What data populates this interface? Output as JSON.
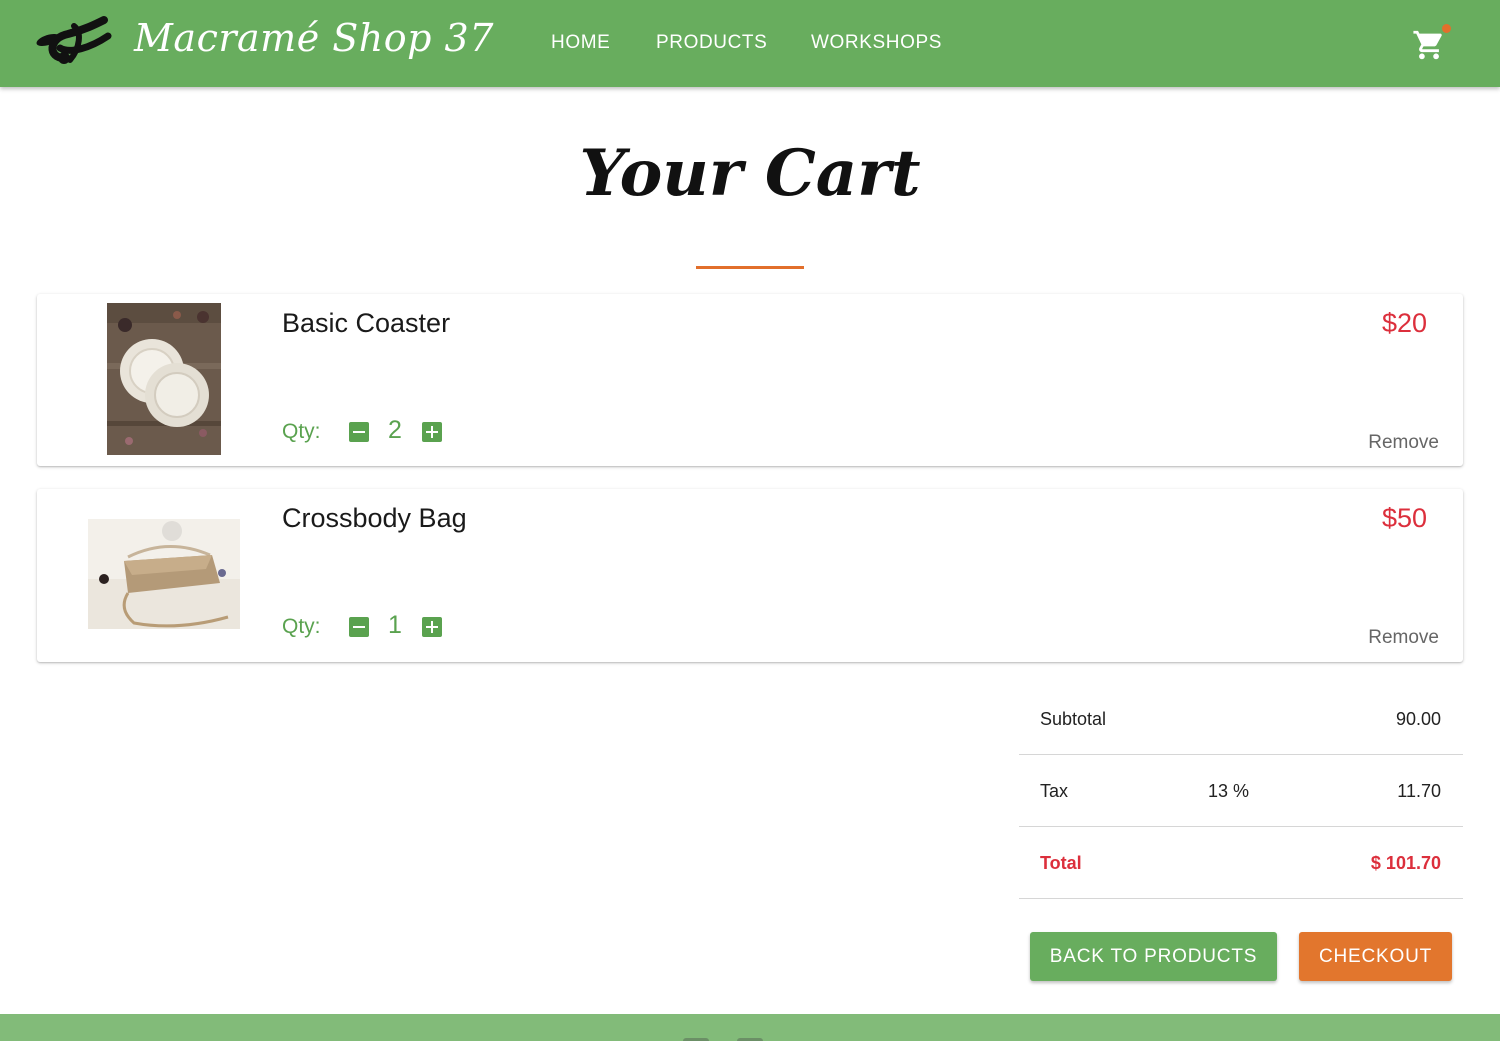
{
  "header": {
    "brand": "Macramé Shop 37",
    "nav": [
      "HOME",
      "PRODUCTS",
      "WORKSHOPS"
    ],
    "cart_icon": "shopping-cart-icon",
    "logo_icon": "knot-logo-icon"
  },
  "page": {
    "title": "Your Cart"
  },
  "cart": {
    "qty_label": "Qty:",
    "remove_label": "Remove",
    "items": [
      {
        "name": "Basic Coaster",
        "price": "$20",
        "qty": "2"
      },
      {
        "name": "Crossbody Bag",
        "price": "$50",
        "qty": "1"
      }
    ]
  },
  "summary": {
    "subtotal_label": "Subtotal",
    "subtotal_value": "90.00",
    "tax_label": "Tax",
    "tax_rate": "13 %",
    "tax_value": "11.70",
    "total_label": "Total",
    "total_value": "$ 101.70"
  },
  "actions": {
    "back_label": "BACK TO PRODUCTS",
    "checkout_label": "CHECKOUT"
  },
  "colors": {
    "brand_green": "#68ad5e",
    "accent_orange": "#e2762d",
    "price_red": "#dc2f3c"
  }
}
